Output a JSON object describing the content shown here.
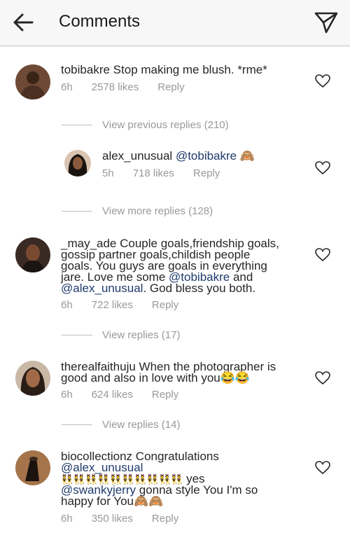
{
  "header": {
    "title": "Comments",
    "back_icon": "back-arrow-icon",
    "send_icon": "direct-send-icon"
  },
  "colors": {
    "link": "#1e3a6b",
    "meta": "#999999"
  },
  "comments": [
    {
      "username": "tobibakre",
      "text_before": "Stop making me blush. *rme*",
      "time": "6h",
      "likes": "2578 likes",
      "reply": "Reply"
    },
    {
      "username": "alex_unusual",
      "mention": "@tobibakre",
      "emoji": "🙈",
      "time": "5h",
      "likes": "718 likes",
      "reply": "Reply"
    },
    {
      "username": "_may_ade",
      "line1": "Couple goals,friendship goals,",
      "line2": "gossip partner goals,childish people",
      "line3": "goals. You guys are goals in everything",
      "line4a": "jare. Love me some",
      "mention1": "@tobibakre",
      "line4b": "and",
      "mention2": "@alex_unusual",
      "line5": ". God bless you both.",
      "time": "6h",
      "likes": "722 likes",
      "reply": "Reply"
    },
    {
      "username": "therealfaithuju",
      "line1": "When the photographer is",
      "line2": "good and also in love with you",
      "emoji": "😂😂",
      "time": "6h",
      "likes": "624 likes",
      "reply": "Reply"
    },
    {
      "username": "biocollectionz",
      "line1": "Congratulations",
      "mention1": "@alex_unusual",
      "emoji_row": "👯👯👯👯👯👯👯👯👯👯",
      "line3b": "yes",
      "mention2": "@swankyjerry",
      "line4": "gonna style You I'm so",
      "line5": "happy for You",
      "emoji": "🙈🙈",
      "time": "6h",
      "likes": "350 likes",
      "reply": "Reply"
    }
  ],
  "view_links": {
    "previous": "View previous replies (210)",
    "more": "View more replies (128)",
    "replies_17": "View replies (17)",
    "replies_14": "View replies (14)"
  }
}
